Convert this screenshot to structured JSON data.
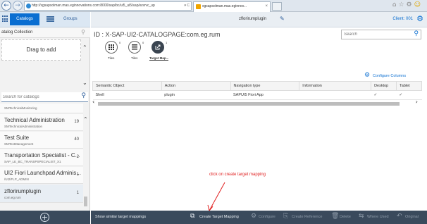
{
  "browser": {
    "address": "http://xgsapsolman.mas.eginnovations.com:8000/sap/bc/ui5_ui5/sap/arsrvc_up",
    "address_ctrl": "▾ C",
    "tab_title": "xgsapsolman.mas.eginnov...",
    "tab_close": "×"
  },
  "sidebar": {
    "catalogs_tab": "Catalogs",
    "groups_tab": "Groups",
    "collection_label": "atalog Collection",
    "drop_zone": "Drag to add",
    "search_placeholder": "Search for catalogs",
    "catalogs": [
      {
        "name": "",
        "id": "SMTechnicalMonitoring",
        "count": ""
      },
      {
        "name": "Technical Administration",
        "id": "SMTechnicalAdministration",
        "count": "19"
      },
      {
        "name": "Test Suite",
        "id": "SMTestManagement",
        "count": "40"
      },
      {
        "name": "Transportation Specialist - C...",
        "id": "SAP_LE_BC_TRANSPSPECIALIST_X1",
        "count": "2"
      },
      {
        "name": "UI2 Fiori Launchpad Adminis...",
        "id": "/UI2/FLP_ADMIN",
        "count": "1"
      },
      {
        "name": "zflorirumplugin",
        "id": "com.eg.rum",
        "count": "1"
      }
    ]
  },
  "main": {
    "title": "zflorirumplugin",
    "client": "Client: 001",
    "identifier": "ID : X-SAP-UI2-CATALOGPAGE:com.eg.rum",
    "search_placeholder": "Search",
    "tiles": [
      {
        "label": "Tiles",
        "count": "0"
      },
      {
        "label": "Tiles",
        "count": "0"
      },
      {
        "label": "Target Map...",
        "count": "1"
      }
    ],
    "configure_columns": "Configure Columns",
    "columns": [
      "Semantic Object",
      "Action",
      "Navigation type",
      "Information",
      "Desktop",
      "Tablet"
    ],
    "rows": [
      [
        "Shell",
        "plugin",
        "SAPUI5 Fiori App",
        "",
        "✓",
        "✓"
      ]
    ]
  },
  "annotation": "click on create target mapping",
  "footer": {
    "show_similar": "Show similar target mappings",
    "create_target_mapping": "Create Target Mapping",
    "configure": "Configure",
    "create_reference": "Create Reference",
    "delete": "Delete",
    "where_used": "Where Used",
    "original": "Original"
  },
  "colors": {
    "accent": "#0a6ed1",
    "footer_bg": "#3a4a5c",
    "annotation": "#e02020"
  }
}
